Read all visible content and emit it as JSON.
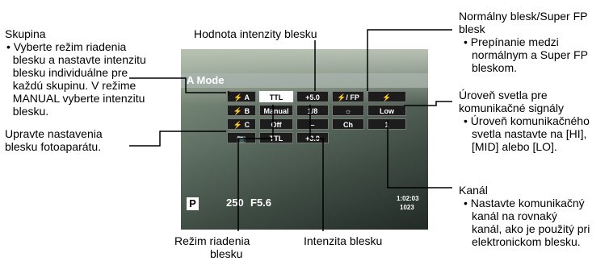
{
  "labels": {
    "skupina_title": "Skupina",
    "skupina_desc": [
      "Vyberte režim riadenia",
      "blesku a nastavte intenzitu",
      "blesku individuálne pre",
      "každú skupinu. V režime",
      "MANUAL vyberte intenzitu",
      "blesku."
    ],
    "adjust": [
      "Upravte nastavenia",
      "blesku fotoaparátu."
    ],
    "intensity_value": "Hodnota intenzity blesku",
    "normal_flash_title": [
      "Normálny blesk/Super FP",
      "blesk"
    ],
    "normal_flash_desc": [
      "Prepínanie medzi",
      "normálnym a Super FP",
      "bleskom."
    ],
    "light_level_title": [
      "Úroveň svetla pre",
      "komunikačné signály"
    ],
    "light_level_desc": [
      "Úroveň komunikačného",
      "svetla nastavte na [HI],",
      "[MID] alebo [LO]."
    ],
    "channel_title": "Kanál",
    "channel_desc": [
      "Nastavte komunikačný",
      "kanál na rovnaký",
      "kanál, ako je použitý pri",
      "elektronickom blesku."
    ],
    "control_mode": [
      "Režim riadenia",
      "blesku"
    ],
    "intensity": "Intenzita blesku"
  },
  "screen": {
    "mode_title": "A Mode",
    "groups": [
      "A",
      "B",
      "C"
    ],
    "modes": [
      "TTL",
      "Manual",
      "Off",
      "TTL"
    ],
    "values": [
      "+5.0",
      "1/8",
      "–",
      "+3.0"
    ],
    "right_col_labels": [
      "/ FP",
      "",
      "Ch"
    ],
    "right_col_values": [
      "",
      "Low",
      "1"
    ],
    "mode_letter": "P",
    "shutter": "250",
    "aperture": "F5.6",
    "time": "1:02:03",
    "shots": "1023"
  }
}
